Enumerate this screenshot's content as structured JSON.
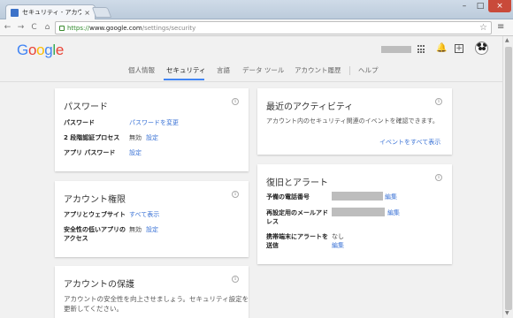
{
  "browser": {
    "tab_title": "セキュリティ - アカウント設定",
    "tab_close": "×",
    "url_scheme": "https://",
    "url_host": "www.google.com",
    "url_path": "/settings/security",
    "back_glyph": "←",
    "forward_glyph": "→",
    "reload_glyph": "C",
    "home_glyph": "⌂",
    "star_glyph": "☆",
    "menu_glyph": "≡",
    "win_min": "–",
    "win_max": "□",
    "win_close": "×"
  },
  "header": {
    "logo_letters": [
      "G",
      "o",
      "o",
      "g",
      "l",
      "e"
    ],
    "plus_glyph": "+",
    "bell_glyph": "🔔"
  },
  "subnav": {
    "items": [
      {
        "label": "個人情報",
        "active": false
      },
      {
        "label": "セキュリティ",
        "active": true
      },
      {
        "label": "言語",
        "active": false
      },
      {
        "label": "データ ツール",
        "active": false
      },
      {
        "label": "アカウント履歴",
        "active": false
      },
      {
        "label": "ヘルプ",
        "active": false
      }
    ]
  },
  "password_card": {
    "title": "パスワード",
    "rows": {
      "password_label": "パスワード",
      "password_link": "パスワードを変更",
      "two_step_label": "2 段階認証プロセス",
      "two_step_status": "無効",
      "two_step_link": "設定",
      "app_password_label": "アプリ パスワード",
      "app_password_link": "設定"
    }
  },
  "permissions_card": {
    "title": "アカウント権限",
    "apps_label": "アプリとウェブサイト",
    "apps_link": "すべて表示",
    "less_secure_label_1": "安全性の低いアプリの",
    "less_secure_label_2": "アクセス",
    "less_secure_status": "無効",
    "less_secure_link": "設定"
  },
  "protection_card": {
    "title": "アカウントの保護",
    "desc_1": "アカウントの安全性を向上させましょう。セキュリティ設定を",
    "desc_2": "更新してください。"
  },
  "activity_card": {
    "title": "最近のアクティビティ",
    "desc": "アカウント内のセキュリティ関連のイベントを確認できます。",
    "link": "イベントをすべて表示"
  },
  "recovery_card": {
    "title": "復旧とアラート",
    "phone_label": "予備の電話番号",
    "phone_link": "編集",
    "email_label_1": "再設定用のメールアド",
    "email_label_2": "レス",
    "email_link": "編集",
    "alert_label_1": "携帯端末にアラートを",
    "alert_label_2": "送信",
    "alert_value": "なし",
    "alert_link": "編集"
  },
  "info_glyph": "i",
  "scrollbar": {
    "up": "▲",
    "down": "▼"
  },
  "colors": {
    "accent": "#4285f4",
    "link": "#3b73d6",
    "ssl_green": "#2e8a2a"
  }
}
